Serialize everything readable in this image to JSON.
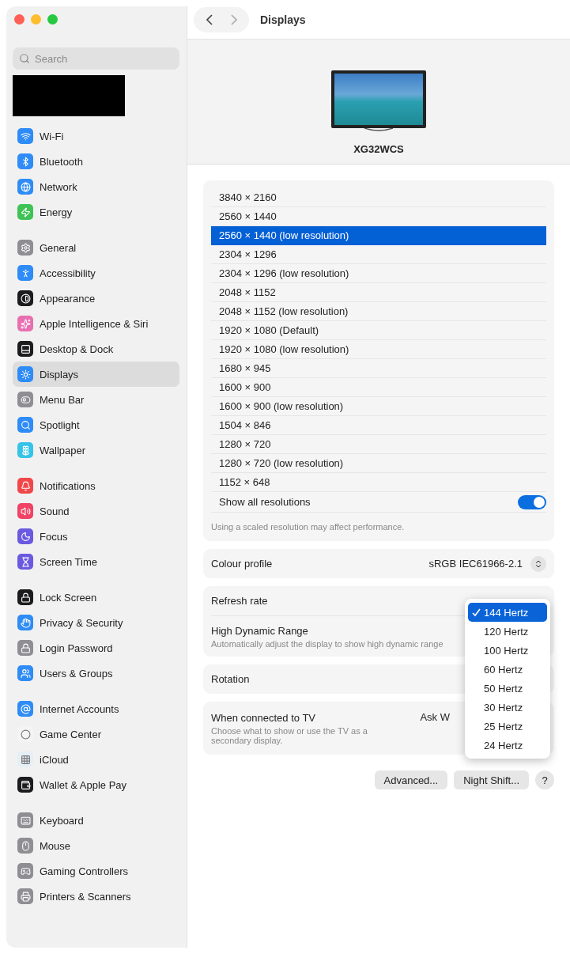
{
  "toolbar": {
    "title": "Displays"
  },
  "sidebar": {
    "search": {
      "placeholder": "Search"
    },
    "groups": [
      [
        {
          "label": "Wi-Fi",
          "color": "#2f8cf6",
          "selected": false
        },
        {
          "label": "Bluetooth",
          "color": "#2f8cf6",
          "selected": false
        },
        {
          "label": "Network",
          "color": "#2f8cf6",
          "selected": false
        },
        {
          "label": "Energy",
          "color": "#3fc356",
          "selected": false
        }
      ],
      [
        {
          "label": "General",
          "color": "#8e8e93",
          "selected": false
        },
        {
          "label": "Accessibility",
          "color": "#2f8cf6",
          "selected": false
        },
        {
          "label": "Appearance",
          "color": "#1c1c1e",
          "selected": false
        },
        {
          "label": "Apple Intelligence & Siri",
          "color": "#e86fb0",
          "selected": false
        },
        {
          "label": "Desktop & Dock",
          "color": "#1c1c1e",
          "selected": false
        },
        {
          "label": "Displays",
          "color": "#2f8cf6",
          "selected": true
        },
        {
          "label": "Menu Bar",
          "color": "#8e8e93",
          "selected": false
        },
        {
          "label": "Spotlight",
          "color": "#2f8cf6",
          "selected": false
        },
        {
          "label": "Wallpaper",
          "color": "#35c3e8",
          "selected": false
        }
      ],
      [
        {
          "label": "Notifications",
          "color": "#f0484a",
          "selected": false
        },
        {
          "label": "Sound",
          "color": "#ef4466",
          "selected": false
        },
        {
          "label": "Focus",
          "color": "#6a5ae0",
          "selected": false
        },
        {
          "label": "Screen Time",
          "color": "#6a5ae0",
          "selected": false
        }
      ],
      [
        {
          "label": "Lock Screen",
          "color": "#1c1c1e",
          "selected": false
        },
        {
          "label": "Privacy & Security",
          "color": "#2f8cf6",
          "selected": false
        },
        {
          "label": "Login Password",
          "color": "#8e8e93",
          "selected": false
        },
        {
          "label": "Users & Groups",
          "color": "#2f8cf6",
          "selected": false
        }
      ],
      [
        {
          "label": "Internet Accounts",
          "color": "#2f8cf6",
          "selected": false
        },
        {
          "label": "Game Center",
          "color": "#f4f4f4",
          "selected": false
        },
        {
          "label": "iCloud",
          "color": "#e6eef6",
          "selected": false
        },
        {
          "label": "Wallet & Apple Pay",
          "color": "#1c1c1e",
          "selected": false
        }
      ],
      [
        {
          "label": "Keyboard",
          "color": "#8e8e93",
          "selected": false
        },
        {
          "label": "Mouse",
          "color": "#8e8e93",
          "selected": false
        },
        {
          "label": "Gaming Controllers",
          "color": "#8e8e93",
          "selected": false
        },
        {
          "label": "Printers & Scanners",
          "color": "#8e8e93",
          "selected": false
        }
      ]
    ]
  },
  "display": {
    "name": "XG32WCS"
  },
  "resolutions": {
    "items": [
      {
        "label": "3840 × 2160",
        "selected": false
      },
      {
        "label": "2560 × 1440",
        "selected": false
      },
      {
        "label": "2560 × 1440 (low resolution)",
        "selected": true
      },
      {
        "label": "2304 × 1296",
        "selected": false
      },
      {
        "label": "2304 × 1296 (low resolution)",
        "selected": false
      },
      {
        "label": "2048 × 1152",
        "selected": false
      },
      {
        "label": "2048 × 1152 (low resolution)",
        "selected": false
      },
      {
        "label": "1920 × 1080 (Default)",
        "selected": false
      },
      {
        "label": "1920 × 1080 (low resolution)",
        "selected": false
      },
      {
        "label": "1680 × 945",
        "selected": false
      },
      {
        "label": "1600 × 900",
        "selected": false
      },
      {
        "label": "1600 × 900 (low resolution)",
        "selected": false
      },
      {
        "label": "1504 × 846",
        "selected": false
      },
      {
        "label": "1280 × 720",
        "selected": false
      },
      {
        "label": "1280 × 720 (low resolution)",
        "selected": false
      },
      {
        "label": "1152 × 648",
        "selected": false
      }
    ],
    "show_all": {
      "label": "Show all resolutions",
      "on": true
    },
    "note": "Using a scaled resolution may affect performance."
  },
  "colour_profile": {
    "label": "Colour profile",
    "value": "sRGB IEC61966-2.1"
  },
  "refresh_rate": {
    "label": "Refresh rate",
    "menu": [
      {
        "label": "144 Hertz",
        "selected": true
      },
      {
        "label": "120 Hertz",
        "selected": false
      },
      {
        "label": "100 Hertz",
        "selected": false
      },
      {
        "label": "60 Hertz",
        "selected": false
      },
      {
        "label": "50 Hertz",
        "selected": false
      },
      {
        "label": "30 Hertz",
        "selected": false
      },
      {
        "label": "25 Hertz",
        "selected": false
      },
      {
        "label": "24 Hertz",
        "selected": false
      }
    ]
  },
  "hdr": {
    "label": "High Dynamic Range",
    "description": "Automatically adjust the display to show high dynamic range"
  },
  "rotation": {
    "label": "Rotation"
  },
  "tv": {
    "label": "When connected to TV",
    "description": "Choose what to show or use the TV as a secondary display.",
    "value": "Ask W"
  },
  "buttons": [
    "Advanced...",
    "Night Shift...",
    "?"
  ]
}
